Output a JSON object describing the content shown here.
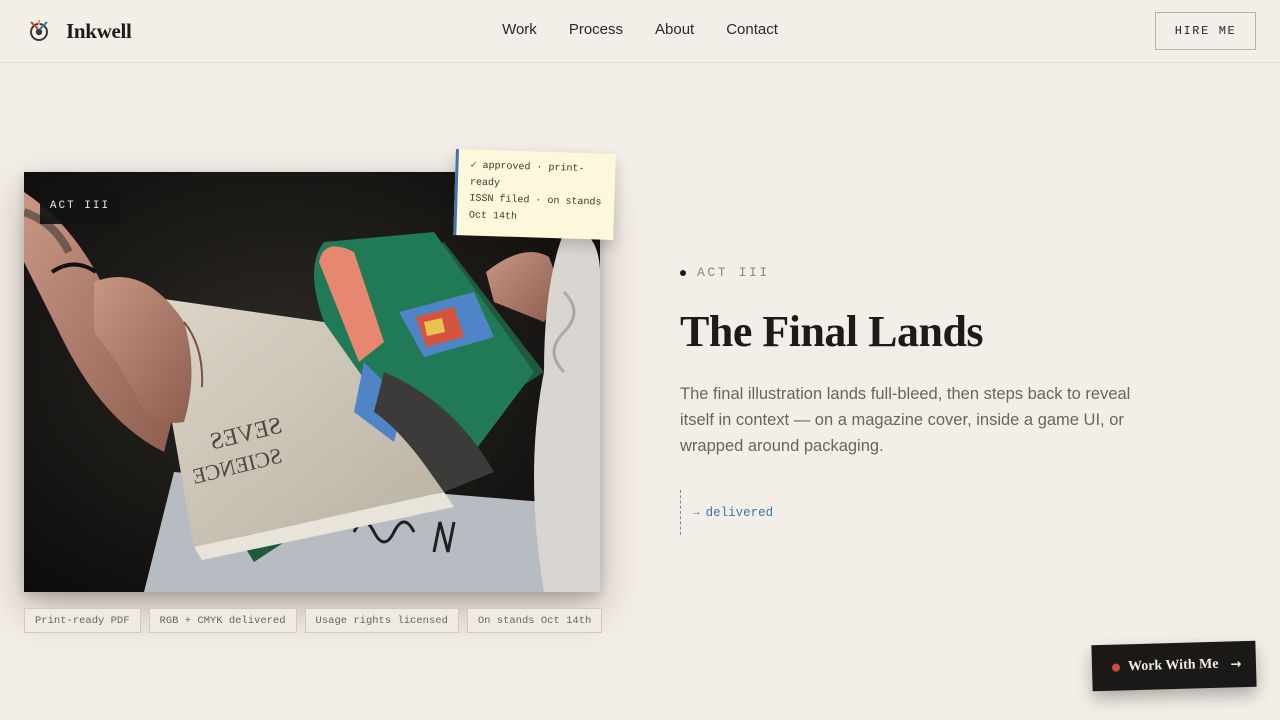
{
  "brand": {
    "name": "Inkwell",
    "logo_icon": "inkwell-logo-icon"
  },
  "nav": {
    "items": [
      "Work",
      "Process",
      "About",
      "Contact"
    ]
  },
  "header": {
    "hire_label": "HIRE ME"
  },
  "photo": {
    "chip_label": "ACT III",
    "content": "hands-holding-open-magazine-illustration"
  },
  "sticky": {
    "line1": "✓ approved · print-ready",
    "line2": "ISSN filed · on stands Oct 14th"
  },
  "tags": [
    "Print-ready PDF",
    "RGB + CMYK delivered",
    "Usage rights licensed",
    "On stands Oct 14th"
  ],
  "section": {
    "eyebrow": "ACT III",
    "title": "The Final Lands",
    "description": "The final illustration lands full-bleed, then steps back to reveal itself in context — on a magazine cover, inside a game UI, or wrapped around packaging.",
    "status_arrow": "→",
    "status": "delivered"
  },
  "cta": {
    "label": "Work With Me",
    "arrow": "→"
  },
  "colors": {
    "background": "#f3eee7",
    "ink": "#1c1b19",
    "accent_blue": "#3f76a8",
    "accent_red": "#d24b3d",
    "note": "#fdf8dc"
  }
}
